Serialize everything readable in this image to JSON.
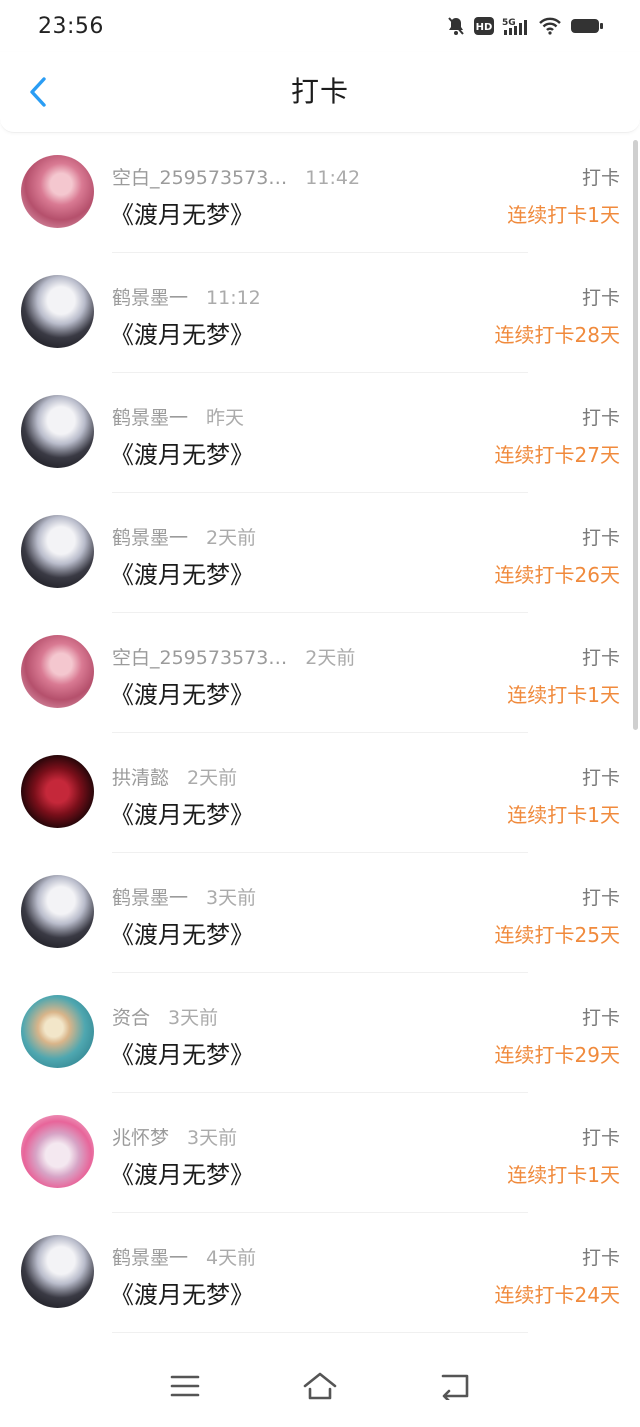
{
  "status_bar": {
    "time": "23:56",
    "icons": [
      "bell-muted-icon",
      "hd-icon",
      "signal-5g-icon",
      "wifi-icon",
      "battery-icon"
    ],
    "hd_label": "HD",
    "network_label": "5G"
  },
  "header": {
    "back_icon": "chevron-left-icon",
    "title": "打卡"
  },
  "colors": {
    "accent_orange": "#f08a3c",
    "back_blue": "#2a9df4",
    "muted_text": "#9b9b9b"
  },
  "checkins": [
    {
      "name": "空白_259573573…",
      "time": "11:42",
      "book": "《渡月无梦》",
      "action": "打卡",
      "streak": "连续打卡1天",
      "avatar": "pink-hair-avatar"
    },
    {
      "name": "鹤景墨一",
      "time": "11:12",
      "book": "《渡月无梦》",
      "action": "打卡",
      "streak": "连续打卡28天",
      "avatar": "white-hair-avatar"
    },
    {
      "name": "鹤景墨一",
      "time": "昨天",
      "book": "《渡月无梦》",
      "action": "打卡",
      "streak": "连续打卡27天",
      "avatar": "white-hair-avatar"
    },
    {
      "name": "鹤景墨一",
      "time": "2天前",
      "book": "《渡月无梦》",
      "action": "打卡",
      "streak": "连续打卡26天",
      "avatar": "white-hair-avatar"
    },
    {
      "name": "空白_259573573…",
      "time": "2天前",
      "book": "《渡月无梦》",
      "action": "打卡",
      "streak": "连续打卡1天",
      "avatar": "pink-hair-avatar"
    },
    {
      "name": "拱清懿",
      "time": "2天前",
      "book": "《渡月无梦》",
      "action": "打卡",
      "streak": "连续打卡1天",
      "avatar": "red-heart-avatar"
    },
    {
      "name": "鹤景墨一",
      "time": "3天前",
      "book": "《渡月无梦》",
      "action": "打卡",
      "streak": "连续打卡25天",
      "avatar": "white-hair-avatar"
    },
    {
      "name": "资合",
      "time": "3天前",
      "book": "《渡月无梦》",
      "action": "打卡",
      "streak": "连续打卡29天",
      "avatar": "sea-creature-avatar"
    },
    {
      "name": "兆怀梦",
      "time": "3天前",
      "book": "《渡月无梦》",
      "action": "打卡",
      "streak": "连续打卡1天",
      "avatar": "flower-girl-avatar"
    },
    {
      "name": "鹤景墨一",
      "time": "4天前",
      "book": "《渡月无梦》",
      "action": "打卡",
      "streak": "连续打卡24天",
      "avatar": "white-hair-avatar"
    }
  ],
  "nav_bar": {
    "icons": [
      "menu-icon",
      "home-icon",
      "back-icon"
    ]
  }
}
